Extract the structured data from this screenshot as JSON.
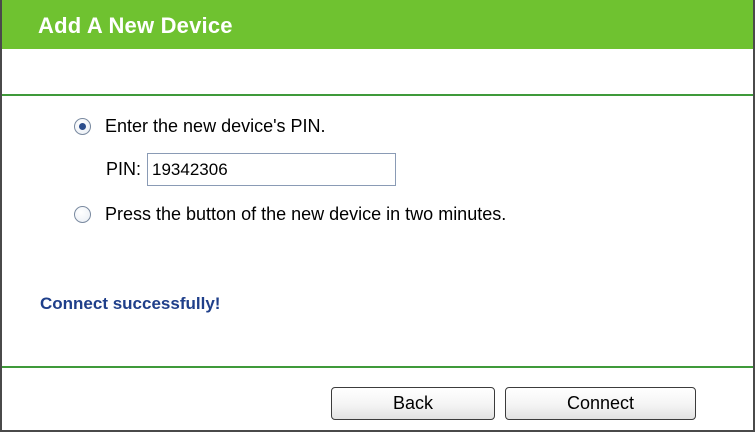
{
  "header": {
    "title": "Add A New Device"
  },
  "options": {
    "pin": {
      "label": "Enter the new device's PIN.",
      "checked": true
    },
    "push": {
      "label": "Press the button of the new device in two minutes.",
      "checked": false
    }
  },
  "pin_field": {
    "label": "PIN:",
    "value": "19342306"
  },
  "status": {
    "text": "Connect successfully!",
    "color": "#1f3f8a"
  },
  "buttons": {
    "back": "Back",
    "connect": "Connect"
  },
  "colors": {
    "header_bg": "#6fc230",
    "rule": "#3f9a3a"
  }
}
